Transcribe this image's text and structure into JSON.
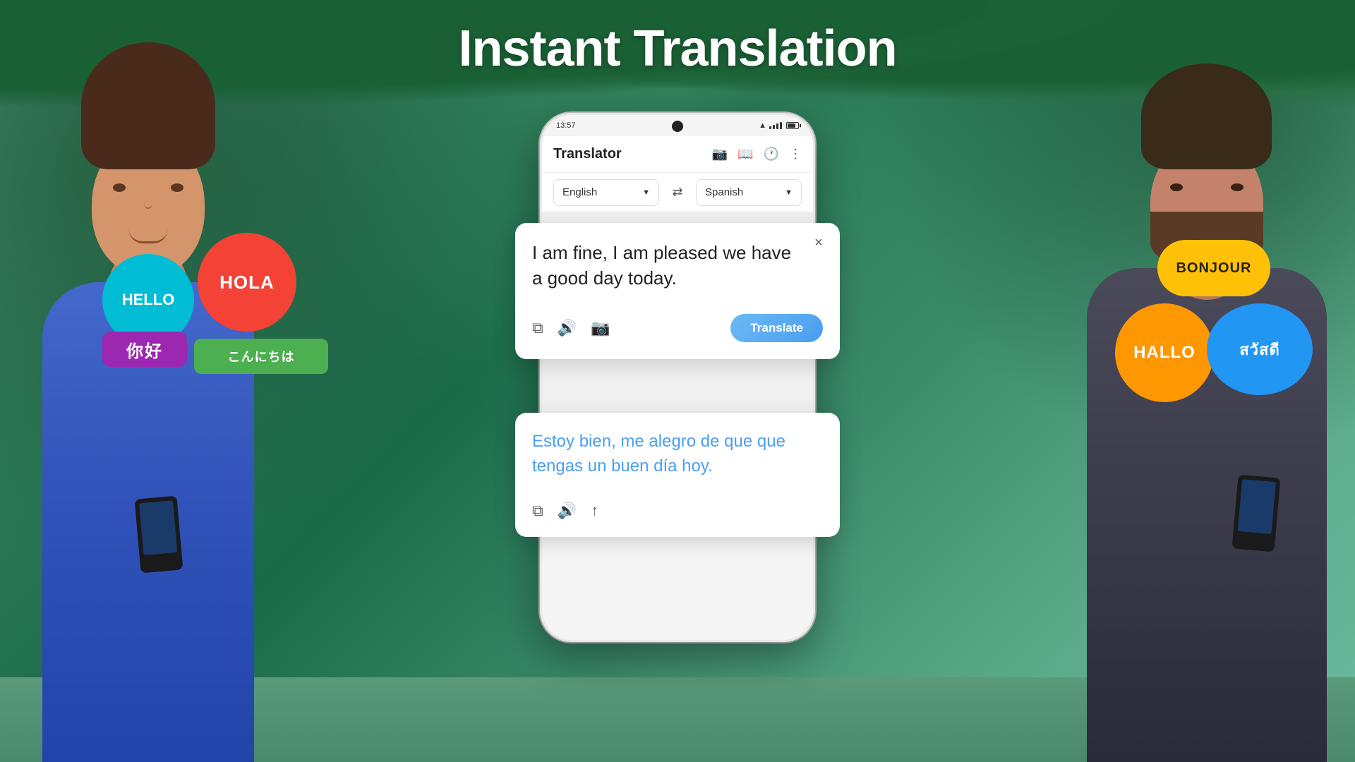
{
  "page": {
    "title": "Instant Translation",
    "background_color": "#3a8a6a"
  },
  "phone": {
    "status_bar": {
      "time": "13:57"
    },
    "app_title": "Translator",
    "icons": {
      "camera": "📷",
      "book": "📖",
      "history": "🕐",
      "more": "⋮"
    },
    "language_bar": {
      "source_lang": "English",
      "target_lang": "Spanish",
      "swap_icon": "⇄"
    }
  },
  "source_card": {
    "text": "I am fine, I am pleased we have a good day today.",
    "close_icon": "×",
    "actions": {
      "copy_icon": "⧉",
      "speaker_icon": "🔊",
      "camera_icon": "📷"
    },
    "translate_button": "Translate"
  },
  "result_card": {
    "text": "Estoy bien, me alegro de que que tengas un buen día hoy.",
    "actions": {
      "copy_icon": "⧉",
      "speaker_icon": "🔊",
      "share_icon": "↑"
    }
  },
  "bubbles": {
    "left": [
      {
        "id": "hello",
        "text": "HELLO",
        "color": "#00bcd4",
        "shape": "circle"
      },
      {
        "id": "hola",
        "text": "HOLA",
        "color": "#f44336",
        "shape": "circle"
      },
      {
        "id": "nihao",
        "text": "你好",
        "color": "#9c27b0",
        "shape": "rect"
      },
      {
        "id": "konnichiwa",
        "text": "こんにちは",
        "color": "#4caf50",
        "shape": "rect"
      }
    ],
    "right": [
      {
        "id": "bonjour",
        "text": "BONJOUR",
        "color": "#ffc107",
        "shape": "cloud"
      },
      {
        "id": "hallo",
        "text": "HALLO",
        "color": "#ff9800",
        "shape": "circle"
      },
      {
        "id": "sawatdi",
        "text": "สวัสดี",
        "color": "#2196f3",
        "shape": "circle"
      }
    ]
  }
}
